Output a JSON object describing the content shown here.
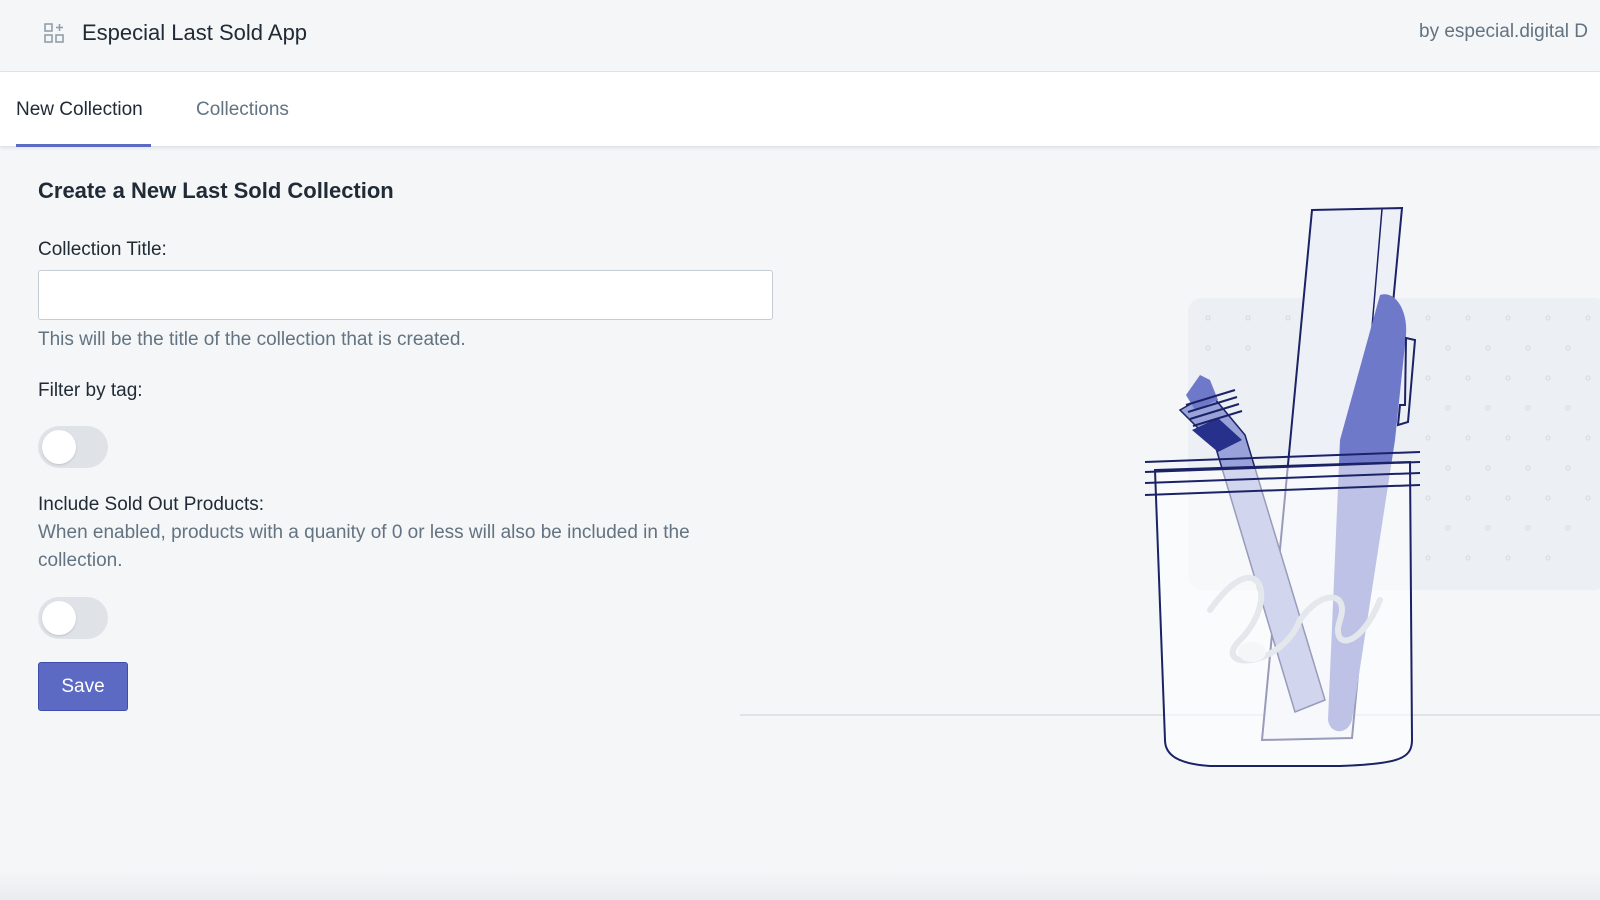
{
  "header": {
    "app_title": "Especial Last Sold App",
    "byline": "by especial.digital D",
    "icon": "apps-grid-icon"
  },
  "tabs": [
    {
      "label": "New Collection",
      "active": true
    },
    {
      "label": "Collections",
      "active": false
    }
  ],
  "form": {
    "heading": "Create a New Last Sold Collection",
    "title_label": "Collection Title:",
    "title_value": "",
    "title_placeholder": "",
    "title_help": "This will be the title of the collection that is created.",
    "tag_label": "Filter by tag:",
    "tag_toggle_on": false,
    "sold_label": "Include Sold Out Products:",
    "sold_help": "When enabled, products with a quanity of 0 or less will also be included in the collection.",
    "sold_toggle_on": false,
    "save_label": "Save"
  },
  "colors": {
    "accent": "#5c6ac4",
    "background": "#f4f6f8",
    "text": "#212b36",
    "subdued": "#637381"
  },
  "illustration": "pencil-cup-illustration"
}
